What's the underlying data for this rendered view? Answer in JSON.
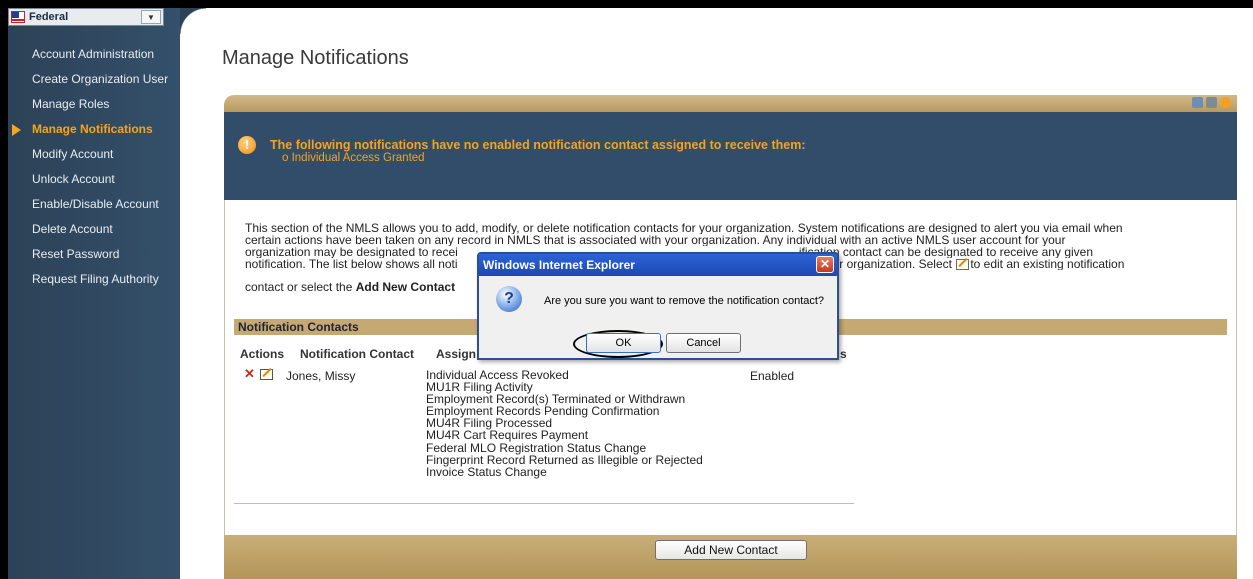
{
  "org_selector": {
    "value": "Federal"
  },
  "sidebar": {
    "items": [
      {
        "label": "Account Administration",
        "active": false
      },
      {
        "label": "Create Organization User",
        "active": false
      },
      {
        "label": "Manage Roles",
        "active": false
      },
      {
        "label": "Manage Notifications",
        "active": true
      },
      {
        "label": "Modify Account",
        "active": false
      },
      {
        "label": "Unlock Account",
        "active": false
      },
      {
        "label": "Enable/Disable Account",
        "active": false
      },
      {
        "label": "Delete Account",
        "active": false
      },
      {
        "label": "Reset Password",
        "active": false
      },
      {
        "label": "Request Filing Authority",
        "active": false
      }
    ]
  },
  "page": {
    "title": "Manage Notifications"
  },
  "header_icons": [
    "people-icon",
    "print-icon",
    "help-icon"
  ],
  "alert": {
    "title": "The following notifications have no enabled notification contact assigned to receive them:",
    "item": "o  Individual Access Granted"
  },
  "intro": {
    "line1": "This section of the NMLS allows you to add, modify, or delete notification contacts for your organization. System notifications are designed to alert you via email when",
    "line2": "certain actions have been taken on any record in NMLS that is associated with your organization. Any individual with an active NMLS user account for your",
    "line3a": "organization may be designated to recei",
    "line3b": "ification contact can be designated to receive any given",
    "line4a": "notification. The list below shows all noti",
    "line4b": "r your organization. Select",
    "line4c": "to edit an existing notification",
    "line5a": "contact or select the ",
    "line5b": "Add New Contact"
  },
  "section": {
    "title": "Notification Contacts"
  },
  "table": {
    "headers": [
      "Actions",
      "Notification Contact",
      "Assign",
      "s"
    ],
    "row": {
      "contact": "Jones, Missy",
      "status": "Enabled",
      "notifications": [
        "Individual Access Revoked",
        "MU1R Filing Activity",
        "Employment Record(s) Terminated or Withdrawn",
        "Employment Records Pending Confirmation",
        "MU4R Filing Processed",
        "MU4R Cart Requires Payment",
        "Federal MLO Registration Status Change",
        "Fingerprint Record Returned as Illegible or Rejected",
        "Invoice Status Change"
      ]
    }
  },
  "footer": {
    "add_button": "Add New Contact"
  },
  "dialog": {
    "title": "Windows Internet Explorer",
    "message": "Are you sure you want to remove the notification contact?",
    "ok_label": "OK",
    "cancel_label": "Cancel",
    "icon": "question-icon"
  },
  "colors": {
    "sidebar_bg": "#2c4257",
    "active_nav": "#f5a51c",
    "alert_bg": "#314d6a",
    "alert_text": "#f4a320",
    "tan_bar": "#c5a872",
    "dialog_title": "#2c63d6"
  }
}
